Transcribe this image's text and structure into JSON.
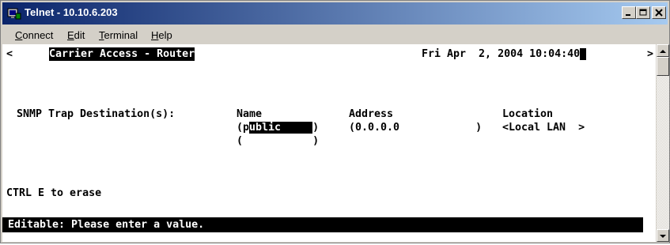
{
  "window": {
    "title": "Telnet - 10.10.6.203"
  },
  "menu": {
    "connect": {
      "first": "C",
      "rest": "onnect"
    },
    "edit": {
      "first": "E",
      "rest": "dit"
    },
    "terminal": {
      "first": "T",
      "rest": "erminal"
    },
    "help": {
      "first": "H",
      "rest": "elp"
    }
  },
  "screen": {
    "left_marker": "<",
    "system_name": "Carrier Access - Router",
    "datetime": "Fri Apr  2, 2004 10:04:40",
    "right_marker": ">",
    "section_label": "SNMP Trap Destination(s):",
    "col_name": "Name",
    "col_address": "Address",
    "col_location": "Location",
    "row1": {
      "name_open": "(p",
      "name_value": "ublic     ",
      "name_close": ")",
      "address": "(0.0.0.0            )",
      "location": "<Local LAN  >"
    },
    "row2": {
      "name_open": "(",
      "name_value": "           ",
      "name_close": ")"
    },
    "hint": "CTRL E to erase",
    "status": "Editable: Please enter a value."
  }
}
